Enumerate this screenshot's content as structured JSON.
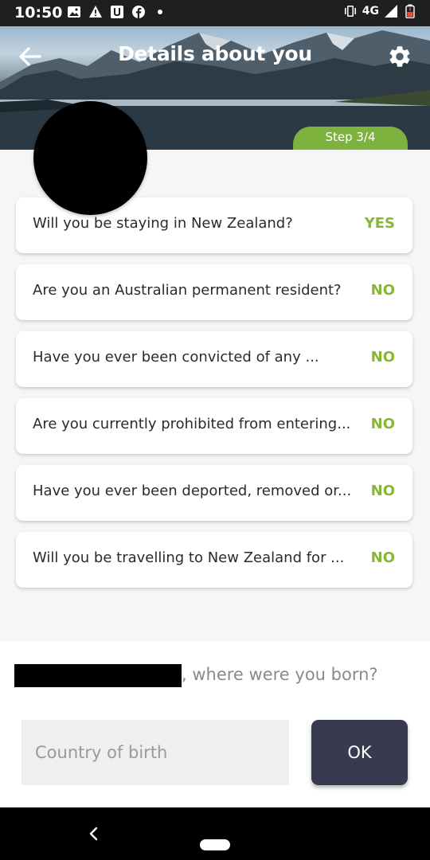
{
  "status_bar": {
    "time": "10:50",
    "network": "4G"
  },
  "header": {
    "title": "Details about you",
    "step": "Step 3/4"
  },
  "questions": [
    {
      "text": "Will you be staying in New Zealand?",
      "answer": "YES"
    },
    {
      "text": "Are you an Australian permanent resident?",
      "answer": "NO"
    },
    {
      "text": "Have you ever been convicted of any ...",
      "answer": "NO"
    },
    {
      "text": "Are you currently prohibited from entering...",
      "answer": "NO"
    },
    {
      "text": "Have you ever been deported, removed or...",
      "answer": "NO"
    },
    {
      "text": "Will you be travelling to New Zealand for ...",
      "answer": "NO"
    }
  ],
  "prompt": {
    "text": ", where were you born?"
  },
  "input": {
    "placeholder": "Country of birth"
  },
  "ok_button": {
    "label": "OK"
  },
  "colors": {
    "accent_green": "#7db23e",
    "answer_green": "#85b832",
    "ok_button": "#383b4f",
    "status_bar": "#1e1f21"
  }
}
